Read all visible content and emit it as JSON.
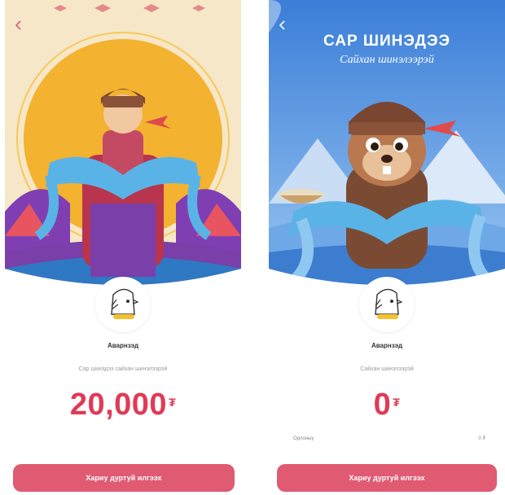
{
  "colors": {
    "accent": "#e03a56",
    "button": "#e05a72",
    "left_bg": "#f6e7c8",
    "right_bg": "#4c8fe0"
  },
  "left": {
    "name": "Аварнзэд",
    "subtitle": "Сар шинэдээ сайхан шинэлээрэй",
    "amount": "20,000",
    "currency": "₮",
    "button": "Хариу дуртуй илгээх"
  },
  "right": {
    "banner_title": "САР ШИНЭДЭЭ",
    "banner_script": "Сайхан шинэлээрэй",
    "name": "Аварнзэд",
    "subtitle": "Сайхан шинэлээрэй",
    "amount": "0",
    "currency": "₮",
    "row_label": "Орлоныу",
    "row_value": "0 ₮",
    "button": "Хариу дуртуй илгээх"
  },
  "icons": {
    "back": "chevron-left-icon",
    "avatar": "eagle-avatar-icon"
  }
}
